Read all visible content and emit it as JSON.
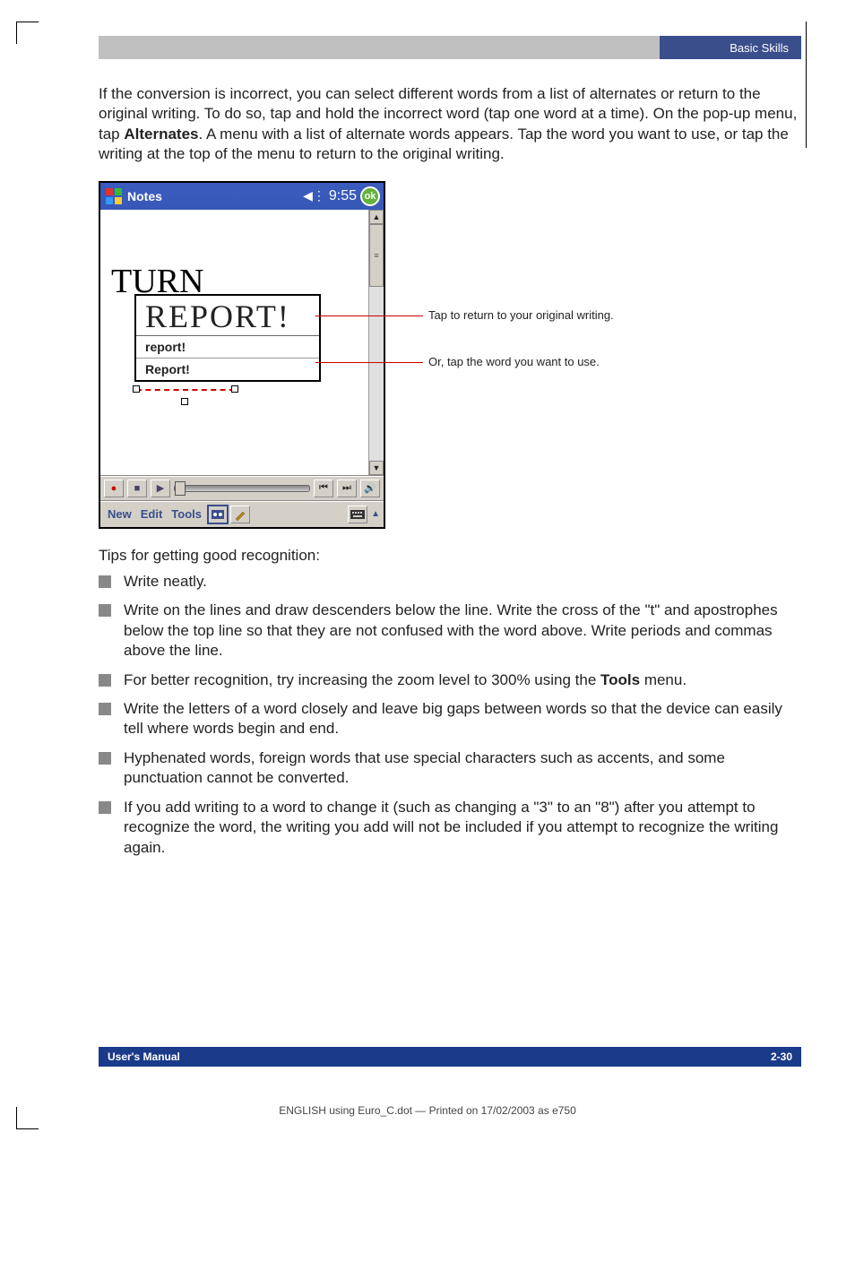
{
  "header": {
    "section": "Basic Skills"
  },
  "intro": {
    "para": "If the conversion is incorrect, you can select different words from a list of alternates or return to the original writing. To do so, tap and hold the incorrect word (tap one word at a time). On the pop-up menu, tap ",
    "bold": "Alternates",
    "rest": ". A menu with a list of alternate words appears. Tap the word you want to use, or tap the writing at the top of the menu to return to the original writing."
  },
  "screenshot": {
    "title": "Notes",
    "time": "9:55",
    "ok": "ok",
    "handwriting_top": "TURN",
    "popup_hand": "REPORT!",
    "popup_opt1": "report!",
    "popup_opt2": "Report!",
    "toolbar": {
      "rec": "●",
      "stop": "■",
      "play": "▶",
      "prev": "⏮",
      "next": "⏭",
      "vol": "🔊"
    },
    "menu": {
      "new": "New",
      "edit": "Edit",
      "tools": "Tools"
    }
  },
  "callouts": {
    "c1": "Tap to return to your original writing.",
    "c2": "Or, tap the word you want to use."
  },
  "tips": {
    "intro": "Tips for getting good recognition:",
    "items": [
      "Write neatly.",
      "Write on the lines and draw descenders below the line. Write the cross of the \"t\" and apostrophes below the top line so that they are not confused with the word above. Write periods and commas above the line.",
      "For better recognition, try increasing the zoom level to 300% using the Tools menu.",
      "Write the letters of a word closely and leave big gaps between words so that the device can easily tell where words begin and end.",
      "Hyphenated words, foreign words that use special characters such as accents, and some punctuation cannot be converted.",
      "If you add writing to a word to change it (such as changing a \"3\" to an \"8\") after you attempt to recognize the word, the writing you add will not be included if you attempt to recognize the writing again."
    ],
    "tools_bold": "Tools"
  },
  "footer": {
    "left": "User's Manual",
    "right": "2-30"
  },
  "printline": "ENGLISH using Euro_C.dot — Printed on 17/02/2003 as e750"
}
